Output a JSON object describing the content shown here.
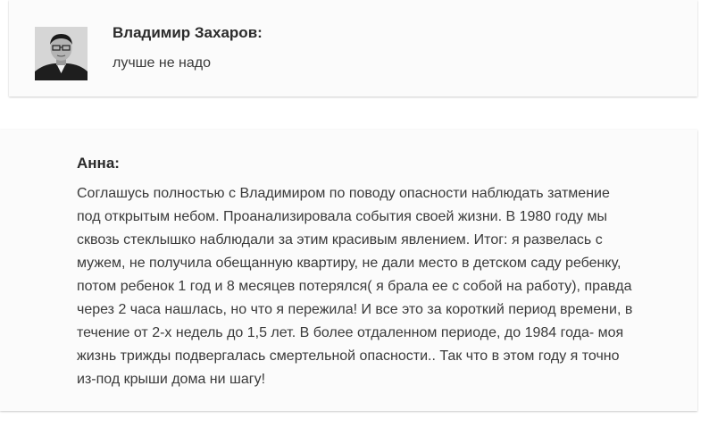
{
  "comments": [
    {
      "author": "Владимир Захаров:",
      "text": "лучше не надо",
      "has_avatar": true
    },
    {
      "author": "Анна:",
      "lines": [
        "Соглашусь полностью с Владимиром по поводу опасности наблюдать затмение",
        "под открытым небом. Проанализировала события своей жизни. В 1980 году мы",
        "сквозь стеклышко наблюдали за этим красивым явлением. Итог: я развелась с",
        "мужем, не получила обещанную квартиру, не дали место в детском саду ребенку,",
        "потом ребенок 1 год и 8 месяцев потерялся( я брала ее с собой на работу), правда",
        "через 2 часа нашлась, но что я пережила! И все это за короткий период времени, в",
        "течение от 2-х недель до 1,5 лет. В более отдаленном периоде, до 1984 года- моя",
        "жизнь трижды подвергалась смертельной опасности.. Так что в этом году я точно",
        "из-под крыши дома ни шагу!"
      ]
    }
  ]
}
